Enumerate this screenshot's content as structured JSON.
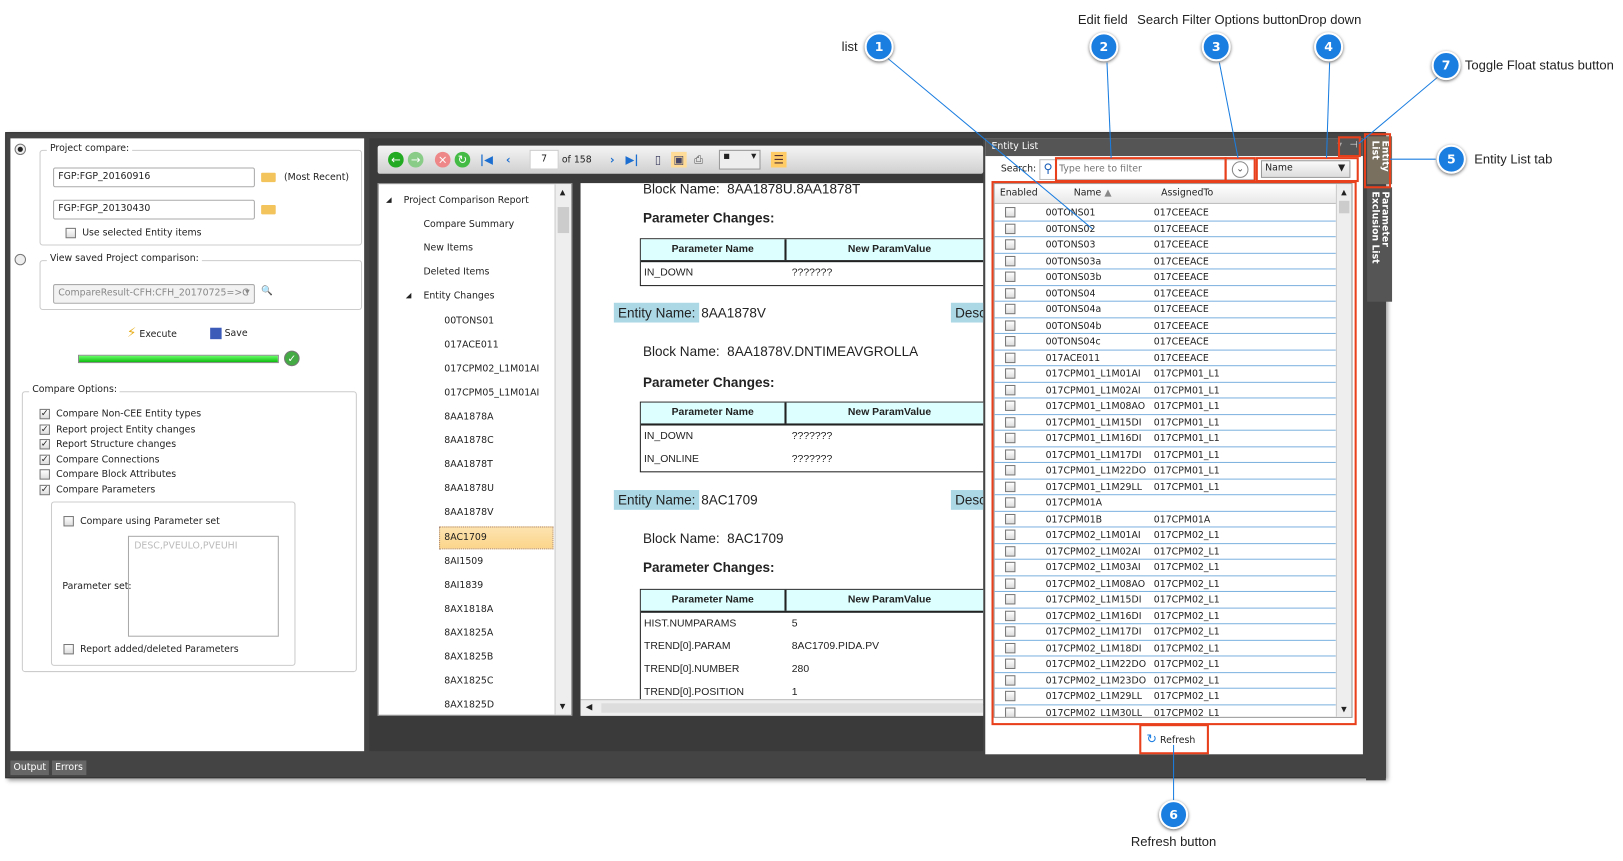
{
  "left": {
    "project_compare_label": "Project compare:",
    "project1": "FGP:FGP_20160916",
    "most_recent": "(Most Recent)",
    "project2": "FGP:FGP_20130430",
    "use_selected": "Use selected Entity items",
    "view_saved_label": "View saved Project comparison:",
    "saved_value": "CompareResult-CFH:CFH_20170725=>C",
    "execute": "Execute",
    "save": "Save",
    "progress_percent": 100,
    "compare_options_label": "Compare Options:",
    "options": [
      {
        "label": "Compare Non-CEE Entity types",
        "checked": true
      },
      {
        "label": "Report project Entity changes",
        "checked": true
      },
      {
        "label": "Report Structure changes",
        "checked": true
      },
      {
        "label": "Compare Connections",
        "checked": true
      },
      {
        "label": "Compare Block Attributes",
        "checked": false
      },
      {
        "label": "Compare Parameters",
        "checked": true
      }
    ],
    "compare_param_set": "Compare using Parameter set",
    "param_set_label": "Parameter set:",
    "param_set_placeholder": "DESC,PVEULO,PVEUHI",
    "report_added": "Report added/deleted Parameters"
  },
  "bottom_tabs": [
    "Output",
    "Errors"
  ],
  "toolbar": {
    "page": "7",
    "of": "of 158"
  },
  "tree": {
    "items": [
      {
        "label": "Project Comparison Report",
        "level": 0,
        "expanded": true
      },
      {
        "label": "Compare Summary",
        "level": 1
      },
      {
        "label": "New Items",
        "level": 1
      },
      {
        "label": "Deleted Items",
        "level": 1
      },
      {
        "label": "Entity Changes",
        "level": 1,
        "expanded": true
      },
      {
        "label": "00TONS01",
        "level": 2
      },
      {
        "label": "017ACE011",
        "level": 2
      },
      {
        "label": "017CPM02_L1M01AI",
        "level": 2
      },
      {
        "label": "017CPM05_L1M01AI",
        "level": 2
      },
      {
        "label": "8AA1878A",
        "level": 2
      },
      {
        "label": "8AA1878C",
        "level": 2
      },
      {
        "label": "8AA1878T",
        "level": 2
      },
      {
        "label": "8AA1878U",
        "level": 2
      },
      {
        "label": "8AA1878V",
        "level": 2
      },
      {
        "label": "8AC1709",
        "level": 2,
        "selected": true
      },
      {
        "label": "8AI1509",
        "level": 2
      },
      {
        "label": "8AI1839",
        "level": 2
      },
      {
        "label": "8AX1818A",
        "level": 2
      },
      {
        "label": "8AX1825A",
        "level": 2
      },
      {
        "label": "8AX1825B",
        "level": 2
      },
      {
        "label": "8AX1825C",
        "level": 2
      },
      {
        "label": "8AX1825D",
        "level": 2
      }
    ]
  },
  "report": {
    "block_name_label": "Block Name:",
    "param_changes": "Parameter Changes:",
    "entity_name_label": "Entity Name:",
    "desc_label": "Desc",
    "col_param": "Parameter Name",
    "col_value": "New ParamValue",
    "block1": "8AA1878U.8AA1878T",
    "table1": [
      [
        "IN_DOWN",
        "???????"
      ]
    ],
    "entity2": "8AA1878V",
    "block2": "8AA1878V.DNTIMEAVGROLLA",
    "table2": [
      [
        "IN_DOWN",
        "???????"
      ],
      [
        "IN_ONLINE",
        "???????"
      ]
    ],
    "entity3": "8AC1709",
    "block3": "8AC1709",
    "table3": [
      [
        "HIST.NUMPARAMS",
        "5"
      ],
      [
        "TREND[0].PARAM",
        "8AC1709.PIDA.PV"
      ],
      [
        "TREND[0].NUMBER",
        "280"
      ],
      [
        "TREND[0].POSITION",
        "1"
      ]
    ]
  },
  "entity_list": {
    "title": "Entity List",
    "search_label": "Search:",
    "search_placeholder": "Type here to filter",
    "search_value": "",
    "filter_field": "Name",
    "columns": [
      "Enabled",
      "Name",
      "AssignedTo"
    ],
    "rows": [
      [
        "00TONS01",
        "017CEEACE"
      ],
      [
        "00TONS02",
        "017CEEACE"
      ],
      [
        "00TONS03",
        "017CEEACE"
      ],
      [
        "00TONS03a",
        "017CEEACE"
      ],
      [
        "00TONS03b",
        "017CEEACE"
      ],
      [
        "00TONS04",
        "017CEEACE"
      ],
      [
        "00TONS04a",
        "017CEEACE"
      ],
      [
        "00TONS04b",
        "017CEEACE"
      ],
      [
        "00TONS04c",
        "017CEEACE"
      ],
      [
        "017ACE011",
        "017CEEACE"
      ],
      [
        "017CPM01_L1M01AI",
        "017CPM01_L1"
      ],
      [
        "017CPM01_L1M02AI",
        "017CPM01_L1"
      ],
      [
        "017CPM01_L1M08AO",
        "017CPM01_L1"
      ],
      [
        "017CPM01_L1M15DI",
        "017CPM01_L1"
      ],
      [
        "017CPM01_L1M16DI",
        "017CPM01_L1"
      ],
      [
        "017CPM01_L1M17DI",
        "017CPM01_L1"
      ],
      [
        "017CPM01_L1M22DO",
        "017CPM01_L1"
      ],
      [
        "017CPM01_L1M29LL",
        "017CPM01_L1"
      ],
      [
        "017CPM01A",
        ""
      ],
      [
        "017CPM01B",
        "017CPM01A"
      ],
      [
        "017CPM02_L1M01AI",
        "017CPM02_L1"
      ],
      [
        "017CPM02_L1M02AI",
        "017CPM02_L1"
      ],
      [
        "017CPM02_L1M03AI",
        "017CPM02_L1"
      ],
      [
        "017CPM02_L1M08AO",
        "017CPM02_L1"
      ],
      [
        "017CPM02_L1M15DI",
        "017CPM02_L1"
      ],
      [
        "017CPM02_L1M16DI",
        "017CPM02_L1"
      ],
      [
        "017CPM02_L1M17DI",
        "017CPM02_L1"
      ],
      [
        "017CPM02_L1M18DI",
        "017CPM02_L1"
      ],
      [
        "017CPM02_L1M22DO",
        "017CPM02_L1"
      ],
      [
        "017CPM02_L1M23DO",
        "017CPM02_L1"
      ],
      [
        "017CPM02_L1M29LL",
        "017CPM02_L1"
      ],
      [
        "017CPM02_L1M30LL",
        "017CPM02_L1"
      ]
    ],
    "refresh": "Refresh"
  },
  "side_tabs": [
    "Entity List",
    "Parameter Exclusion List"
  ],
  "callouts": [
    {
      "n": "1",
      "label": "list"
    },
    {
      "n": "2",
      "label": "Edit field"
    },
    {
      "n": "3",
      "label": "Search Filter Options button"
    },
    {
      "n": "4",
      "label": "Drop down"
    },
    {
      "n": "5",
      "label": "Entity List tab"
    },
    {
      "n": "6",
      "label": "Refresh button"
    },
    {
      "n": "7",
      "label": "Toggle Float status button"
    }
  ],
  "colors": {
    "callout": "#1a7de0",
    "highlight": "#e8401c",
    "header_cell": "#ddffff",
    "entity_label": "#acd8e6",
    "progress": "#22c322"
  }
}
